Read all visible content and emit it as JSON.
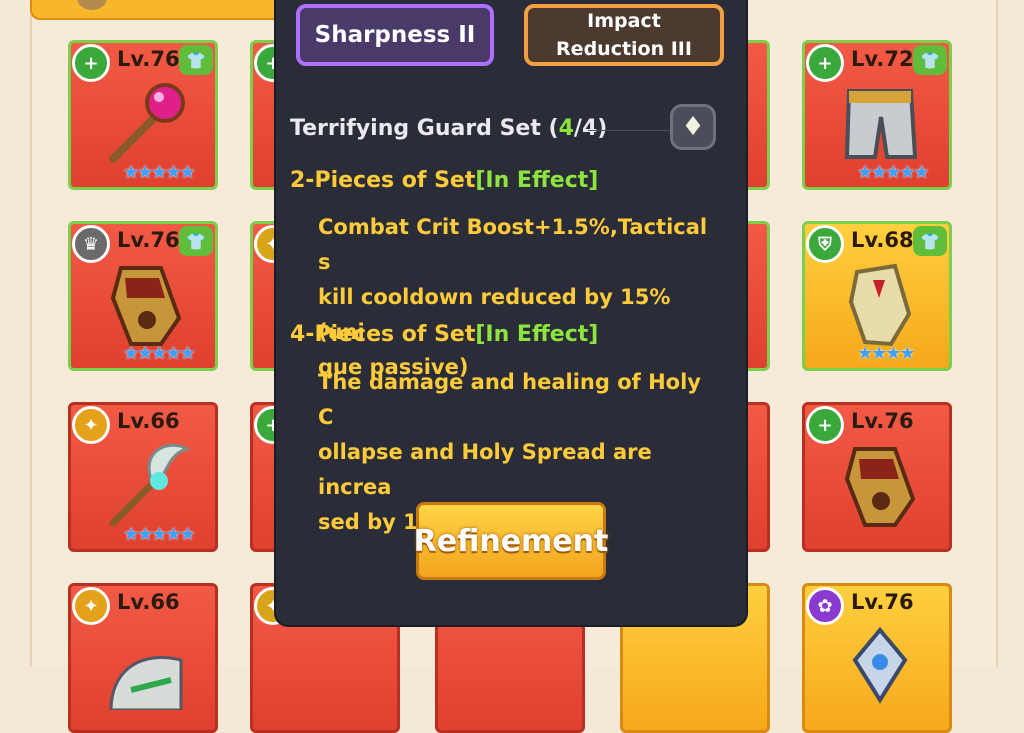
{
  "tags": {
    "primary": "Sharpness II",
    "secondary_line1": "Impact",
    "secondary_line2": "Reduction III"
  },
  "set": {
    "name": "Terrifying Guard Set",
    "count_open": " (",
    "count": "4",
    "count_total": "/4)"
  },
  "bonuses": [
    {
      "label": "2-Pieces of Set",
      "status": "[In Effect]",
      "line1": "Combat Crit Boost+1.5%,Tactical s",
      "line2": "kill cooldown reduced by 15% (uni",
      "line3": "que passive)"
    },
    {
      "label": "4-Pieces of Set",
      "status": "[In Effect]",
      "line1": "The damage and healing of Holy C",
      "line2": "ollapse and Holy Spread are increa",
      "line3": "sed by 110%"
    }
  ],
  "buttons": {
    "refinement": "Refinement"
  },
  "cards": [
    {
      "level": "Lv.76",
      "color": "red",
      "stars": "★★★★★",
      "item": "staff-pink-orb-icon"
    },
    {
      "level": "Lv.72",
      "color": "red",
      "stars": "★★★★★",
      "item": "armor-pants-icon"
    },
    {
      "level": "Lv.76",
      "color": "red",
      "stars": "★★★★★",
      "item": "gauntlet-icon"
    },
    {
      "level": "Lv.68",
      "color": "gold",
      "stars": "★★★★",
      "item": "gauntlet-gold-icon"
    },
    {
      "level": "Lv.66",
      "color": "red",
      "stars": "★★★★★",
      "item": "staff-wing-icon"
    },
    {
      "level": "Lv.76",
      "color": "red",
      "stars": "",
      "item": "gauntlet-icon"
    },
    {
      "level": "Lv.66",
      "color": "red",
      "stars": "",
      "item": "helmet-icon"
    },
    {
      "level": "Lv.76",
      "color": "gold",
      "stars": "",
      "item": "ornament-icon"
    }
  ],
  "colors": {
    "popup_bg": "#2a2d38",
    "accent_yellow": "#ffcb3a",
    "accent_green": "#8ee43f",
    "tag_purple": "#b070ff",
    "tag_orange": "#f5a040"
  }
}
